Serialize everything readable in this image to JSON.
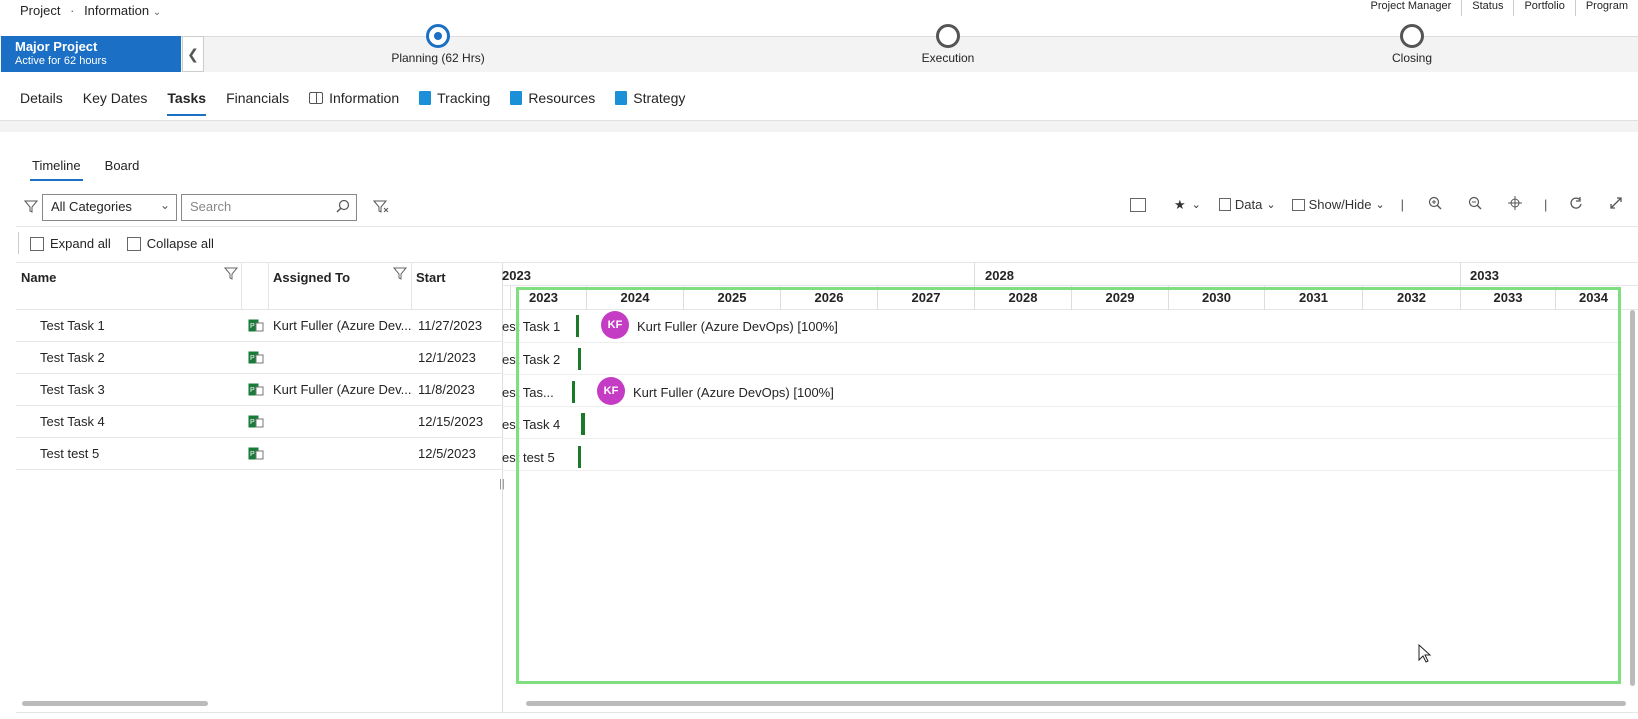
{
  "header": {
    "breadcrumb_project": "Project",
    "breadcrumb_sep": "·",
    "breadcrumb_form": "Information",
    "links": [
      "Project Manager",
      "Status",
      "Portfolio",
      "Program"
    ]
  },
  "stagebar": {
    "project_name": "Major Project",
    "active_text": "Active for 62 hours",
    "stages": [
      {
        "label": "Planning  (62 Hrs)",
        "active": true
      },
      {
        "label": "Execution",
        "active": false
      },
      {
        "label": "Closing",
        "active": false
      }
    ]
  },
  "tabs": [
    "Details",
    "Key Dates",
    "Tasks",
    "Financials",
    "Information",
    "Tracking",
    "Resources",
    "Strategy"
  ],
  "subtabs": [
    "Timeline",
    "Board"
  ],
  "filters": {
    "category_value": "All Categories",
    "search_placeholder": "Search"
  },
  "toolbar": {
    "data_label": "Data",
    "showhide_label": "Show/Hide",
    "expand_all": "Expand all",
    "collapse_all": "Collapse all"
  },
  "grid": {
    "col_name": "Name",
    "col_assigned": "Assigned To",
    "col_start": "Start",
    "rows": [
      {
        "name": "Test Task 1",
        "assigned": "Kurt Fuller (Azure Dev...",
        "start": "11/27/2023",
        "tl_name": "est Task 1",
        "initials": "KF",
        "tl_assigned": "Kurt Fuller (Azure DevOps) [100%]"
      },
      {
        "name": "Test Task 2",
        "assigned": "",
        "start": "12/1/2023",
        "tl_name": "est Task 2",
        "initials": "",
        "tl_assigned": ""
      },
      {
        "name": "Test Task 3",
        "assigned": "Kurt Fuller (Azure Dev...",
        "start": "11/8/2023",
        "tl_name": "est Tas...",
        "initials": "KF",
        "tl_assigned": "Kurt Fuller (Azure DevOps) [100%]"
      },
      {
        "name": "Test Task 4",
        "assigned": "",
        "start": "12/15/2023",
        "tl_name": "est Task 4",
        "initials": "",
        "tl_assigned": ""
      },
      {
        "name": "Test test 5",
        "assigned": "",
        "start": "12/5/2023",
        "tl_name": "est test 5",
        "initials": "",
        "tl_assigned": ""
      }
    ]
  },
  "timeline": {
    "top_years": [
      "2023",
      "2028",
      "2033"
    ],
    "years": [
      "2023",
      "2024",
      "2025",
      "2026",
      "2027",
      "2028",
      "2029",
      "2030",
      "2031",
      "2032",
      "2033",
      "2034"
    ]
  }
}
